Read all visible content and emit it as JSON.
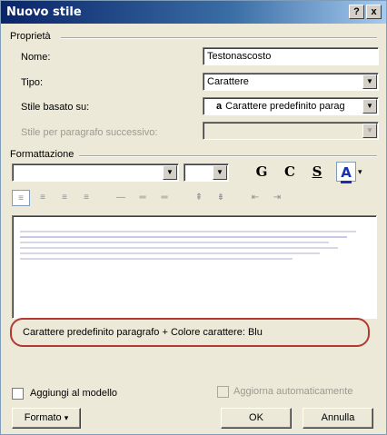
{
  "window": {
    "title": "Nuovo stile",
    "help_button": "?",
    "close_button": "x"
  },
  "properties": {
    "group_label": "Proprietà",
    "name_label": "Nome:",
    "name_value": "Testonascosto",
    "type_label": "Tipo:",
    "type_value": "Carattere",
    "based_on_label": "Stile basato su:",
    "based_on_prefix": "a",
    "based_on_value": "Carattere predefinito parag",
    "next_style_label": "Stile per paragrafo successivo:",
    "next_style_value": ""
  },
  "formatting": {
    "group_label": "Formattazione",
    "font_value": "",
    "size_value": "",
    "bold_label": "G",
    "italic_label": "C",
    "underline_label": "S",
    "color_label": "A"
  },
  "description": "Carattere predefinito paragrafo + Colore carattere: Blu",
  "options": {
    "add_to_template_label": "Aggiungi al modello",
    "auto_update_label": "Aggiorna automaticamente"
  },
  "buttons": {
    "format_label": "Formato",
    "ok_label": "OK",
    "cancel_label": "Annulla"
  }
}
